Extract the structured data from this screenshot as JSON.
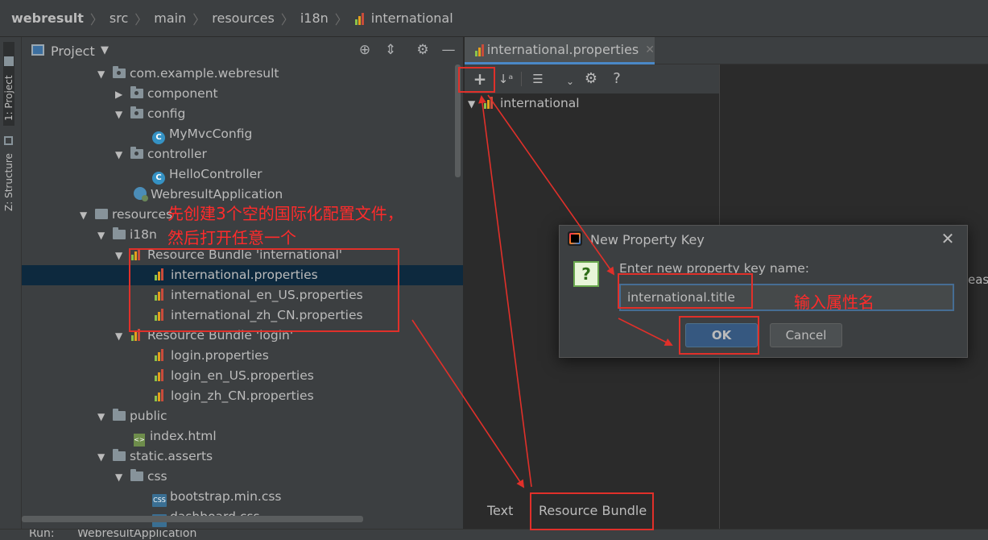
{
  "breadcrumb": [
    "webresult",
    "src",
    "main",
    "resources",
    "i18n",
    "international"
  ],
  "toolstrip": {
    "project_tab": "1: Project",
    "structure_tab": "Z: Structure"
  },
  "project_panel": {
    "title": "Project"
  },
  "tree": [
    {
      "label": "com.example.webresult"
    },
    {
      "label": "component"
    },
    {
      "label": "config"
    },
    {
      "label": "MyMvcConfig"
    },
    {
      "label": "controller"
    },
    {
      "label": "HelloController"
    },
    {
      "label": "WebresultApplication"
    },
    {
      "label": "resources"
    },
    {
      "label": "i18n"
    },
    {
      "label": "Resource Bundle 'international'"
    },
    {
      "label": "international.properties"
    },
    {
      "label": "international_en_US.properties"
    },
    {
      "label": "international_zh_CN.properties"
    },
    {
      "label": "Resource Bundle 'login'"
    },
    {
      "label": "login.properties"
    },
    {
      "label": "login_en_US.properties"
    },
    {
      "label": "login_zh_CN.properties"
    },
    {
      "label": "public"
    },
    {
      "label": "index.html"
    },
    {
      "label": "static.asserts"
    },
    {
      "label": "css"
    },
    {
      "label": "bootstrap.min.css"
    },
    {
      "label": "dashboard.css"
    }
  ],
  "editor": {
    "tab_label": "international.properties",
    "bundle_root": "international",
    "bottom_tabs": [
      "Text",
      "Resource Bundle"
    ],
    "right_clip_text": "eas"
  },
  "dialog": {
    "title": "New Property Key",
    "prompt": "Enter new property key name:",
    "input_value": "international.title",
    "ok_label": "OK",
    "cancel_label": "Cancel"
  },
  "annotations": {
    "note_line1": "先创建3个空的国际化配置文件，",
    "note_line2": "然后打开任意一个",
    "note_input": "输入属性名",
    "color": "#e0302a"
  },
  "run_strip": {
    "label": "Run:",
    "config": "WebresultApplication"
  },
  "colors": {
    "accent": "#4a88c7",
    "selection": "#0d293e",
    "background": "#2b2b2b",
    "panel": "#3c3f41"
  }
}
